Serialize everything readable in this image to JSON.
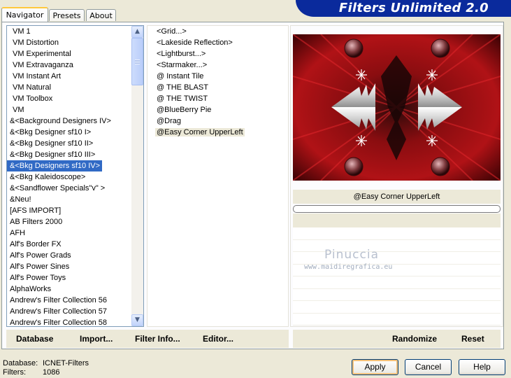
{
  "tabs": [
    {
      "label": "Navigator",
      "active": true
    },
    {
      "label": "Presets",
      "active": false
    },
    {
      "label": "About",
      "active": false
    }
  ],
  "app_title": "Filters Unlimited 2.0",
  "categories": [
    "VM 1",
    "VM Distortion",
    "VM Experimental",
    "VM Extravaganza",
    "VM Instant Art",
    "VM Natural",
    "VM Toolbox",
    "VM",
    "&<Background Designers IV>",
    "&<Bkg Designer sf10 I>",
    "&<Bkg Designer sf10 II>",
    "&<Bkg Designer sf10 III>",
    "&<Bkg Designers sf10 IV>",
    "&<Bkg Kaleidoscope>",
    "&<Sandflower Specials\"v\" >",
    "&Neu!",
    "[AFS IMPORT]",
    "AB Filters 2000",
    "AFH",
    "Alf's Border FX",
    "Alf's Power Grads",
    "Alf's Power Sines",
    "Alf's Power Toys",
    "AlphaWorks",
    "Andrew's Filter Collection 56",
    "Andrew's Filter Collection 57",
    "Andrew's Filter Collection 58"
  ],
  "selected_category": "&<Bkg Designers sf10 IV>",
  "filters": [
    "<Grid...>",
    "<Lakeside Reflection>",
    "<Lightburst...>",
    "<Starmaker...>",
    "@ Instant Tile",
    "@ THE BLAST",
    "@ THE TWIST",
    "@BlueBerry Pie",
    "@Drag",
    "@Easy Corner UpperLeft"
  ],
  "selected_filter": "@Easy Corner UpperLeft",
  "preview_filter_name": "@Easy Corner UpperLeft",
  "progress": 0,
  "watermark": {
    "title": "Pinuccia",
    "url": "www.maidiregrafica.eu"
  },
  "actions_left": {
    "database": "Database",
    "import": "Import...",
    "filter_info": "Filter Info...",
    "editor": "Editor..."
  },
  "actions_right": {
    "randomize": "Randomize",
    "reset": "Reset"
  },
  "footer": {
    "database_label": "Database:",
    "database_value": "ICNET-Filters",
    "filters_label": "Filters:",
    "filters_value": "1086"
  },
  "buttons": {
    "apply": "Apply",
    "cancel": "Cancel",
    "help": "Help"
  },
  "colors": {
    "selection": "#316ac5",
    "banner": "#0a2a9c",
    "preview_dark_red": "#5a0508"
  }
}
